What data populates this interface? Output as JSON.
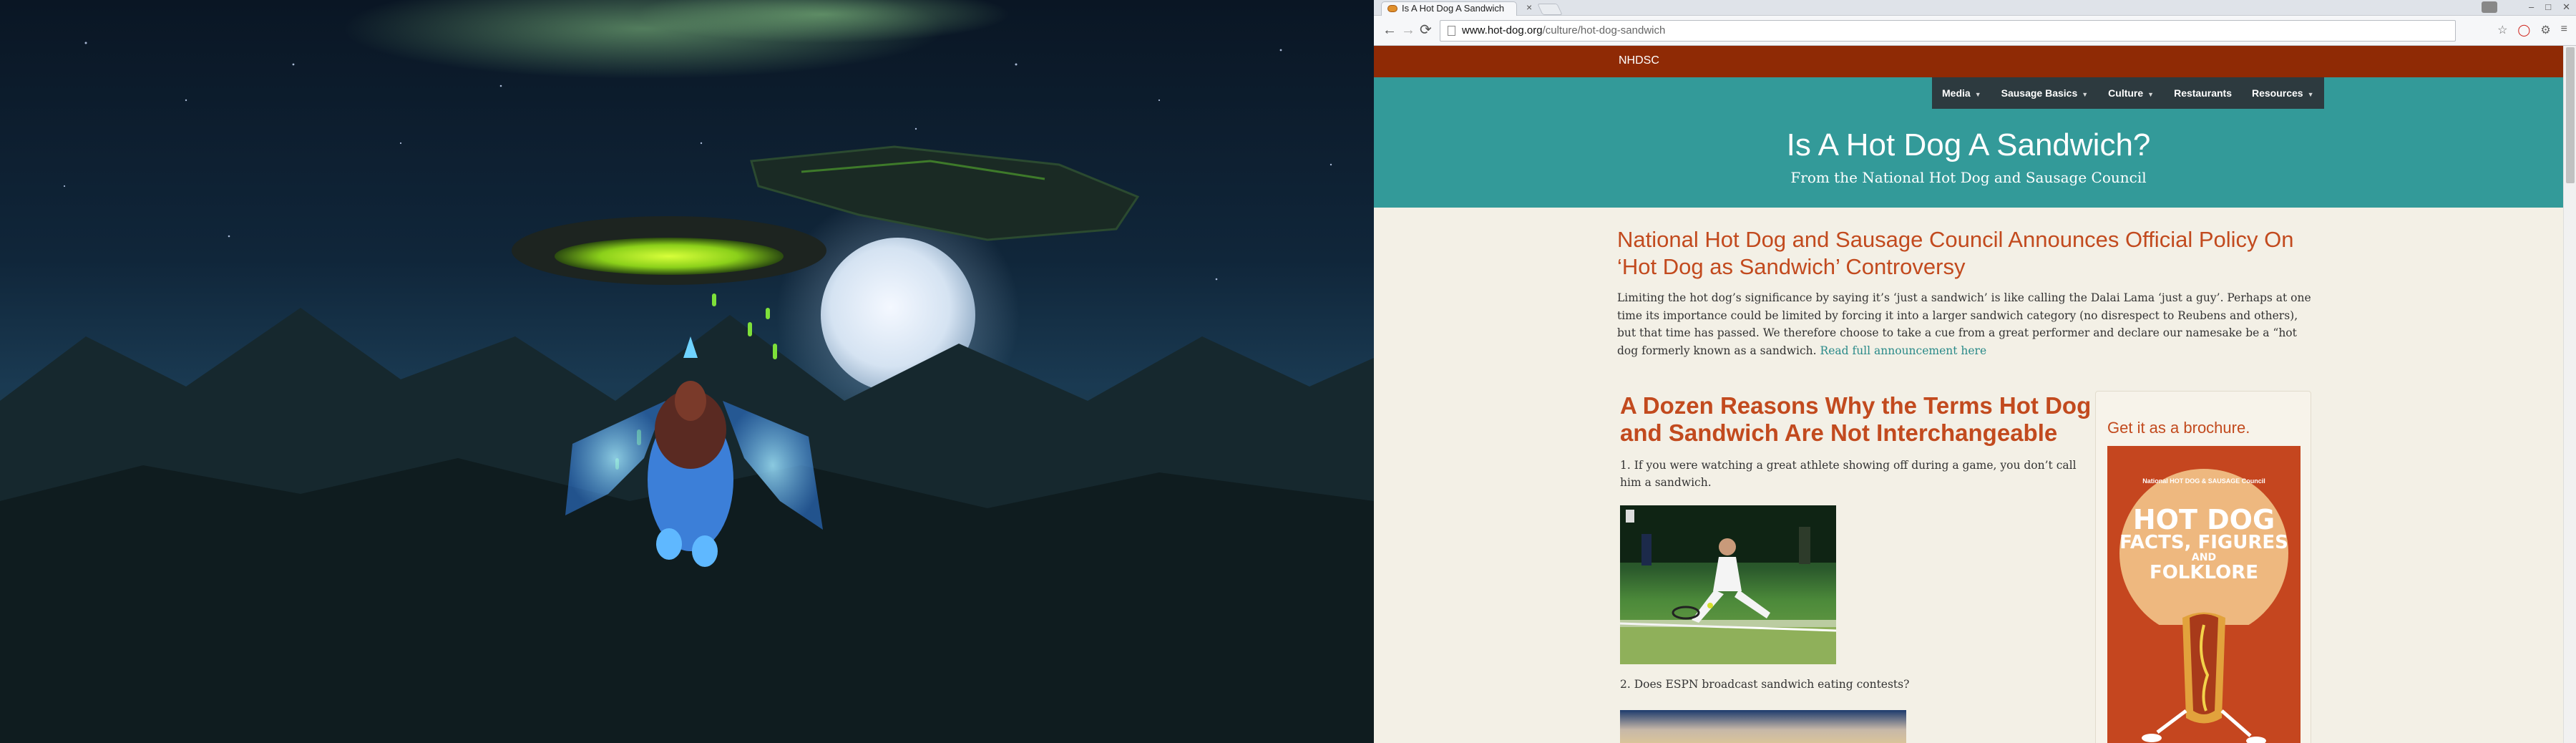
{
  "browser": {
    "tab_title": "Is A Hot Dog A Sandwich",
    "tab_close": "×",
    "url_domain": "www.hot-dog.org",
    "url_path": "/culture/hot-dog-sandwich",
    "window_min": "–",
    "window_max": "□",
    "window_close": "✕"
  },
  "site": {
    "brand": "NHDSC",
    "nav": [
      {
        "label": "Media",
        "has_menu": true
      },
      {
        "label": "Sausage Basics",
        "has_menu": true
      },
      {
        "label": "Culture",
        "has_menu": true
      },
      {
        "label": "Restaurants",
        "has_menu": false
      },
      {
        "label": "Resources",
        "has_menu": true
      }
    ],
    "hero_title": "Is A Hot Dog A Sandwich?",
    "hero_subtitle": "From the National Hot Dog and Sausage Council"
  },
  "article": {
    "announce_heading": "National Hot Dog and Sausage Council Announces Official Policy On ‘Hot Dog as Sandwich’ Controversy",
    "announce_text": "Limiting the hot dog’s significance by saying it’s ‘just a sandwich’ is like calling the Dalai Lama ‘just a guy’. Perhaps at one time its importance could be limited by forcing it into a larger sandwich category (no disrespect to Reubens and others), but that time has passed. We therefore choose to take a cue from a great performer and declare our namesake be a “hot dog formerly known as a sandwich.",
    "announce_link": "Read full announcement here",
    "dozen_heading": "A Dozen Reasons Why the Terms Hot Dog and Sandwich Are Not Interchangeable",
    "reason_1": "1. If you were watching a great athlete showing off during a game, you don’t call him a sandwich.",
    "reason_2": "2. Does ESPN broadcast sandwich eating contests?"
  },
  "sidebar": {
    "heading": "Get it as a brochure.",
    "brochure_logo": "National HOT DOG & SAUSAGE Council",
    "brochure_line1": "HOT DOG",
    "brochure_line2": "FACTS, FIGURES",
    "brochure_line3": "AND",
    "brochure_line4": "FOLKLORE"
  },
  "colors": {
    "topbar": "#8f2a05",
    "teal": "#339a99",
    "menu_bg": "#2d3a3f",
    "heading_orange": "#c24a1e"
  }
}
